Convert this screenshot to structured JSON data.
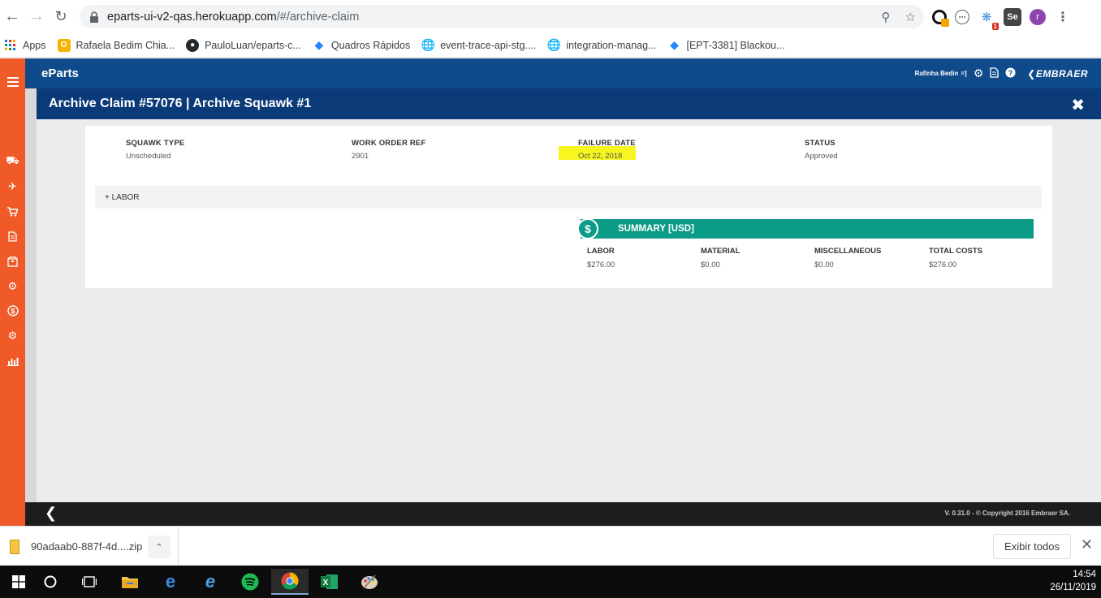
{
  "browser": {
    "url_host": "eparts-ui-v2-qas.herokuapp.com",
    "url_path": "/#/archive-claim",
    "bookmarks": [
      {
        "label": "Apps",
        "icon": "apps-grid-icon"
      },
      {
        "label": "Rafaela Bedim Chia...",
        "icon": "bookmark-o-icon"
      },
      {
        "label": "PauloLuan/eparts-c...",
        "icon": "github-icon"
      },
      {
        "label": "Quadros Rápidos",
        "icon": "jira-diamond-icon"
      },
      {
        "label": "event-trace-api-stg....",
        "icon": "globe-icon"
      },
      {
        "label": "integration-manag...",
        "icon": "globe-icon"
      },
      {
        "label": "[EPT-3381] Blackou...",
        "icon": "jira-diamond-icon"
      }
    ],
    "extensions": [
      {
        "label": "",
        "badge": "",
        "icon": "extension-ring-icon"
      },
      {
        "label": "",
        "badge": "",
        "icon": "extension-circle-icon"
      },
      {
        "label": "",
        "badge": "1",
        "icon": "extension-translate-icon"
      },
      {
        "label": "Se",
        "badge": "",
        "icon": "extension-selenium-icon"
      },
      {
        "label": "r",
        "badge": "",
        "icon": "profile-avatar-icon"
      }
    ]
  },
  "app": {
    "brand": "eParts",
    "user": "Rafinha Bedin",
    "user_suffix": "=]",
    "company": "EMBRAER",
    "modal_title": "Archive Claim #57076 | Archive Squawk #1",
    "close_glyph": "✖",
    "fields": [
      {
        "label": "SQUAWK TYPE",
        "value": "Unscheduled"
      },
      {
        "label": "WORK ORDER REF",
        "value": "2901"
      },
      {
        "label": "FAILURE DATE",
        "value": "Oct 22, 2018"
      },
      {
        "label": "STATUS",
        "value": "Approved"
      }
    ],
    "labor_toggle": "+ LABOR",
    "summary": {
      "title": "SUMMARY [USD]",
      "icon_glyph": "$",
      "columns": [
        {
          "label": "LABOR",
          "value": "$276.00"
        },
        {
          "label": "MATERIAL",
          "value": "$0.00"
        },
        {
          "label": "MISCELLANEOUS",
          "value": "$0.00"
        },
        {
          "label": "TOTAL COSTS",
          "value": "$276.00"
        }
      ]
    },
    "footer_copyright": "V. 0.31.0 - © Copyright 2016 Embraer SA.",
    "rail_icons": [
      "menu-icon",
      "truck-icon",
      "plane-icon",
      "cart-icon",
      "document-icon",
      "package-icon",
      "gear-icon",
      "dollar-circle-icon",
      "gears-icon",
      "bar-chart-icon"
    ]
  },
  "download": {
    "filename": "90adaab0-887f-4d....zip",
    "show_all": "Exibir todos"
  },
  "taskbar": {
    "time": "14:54",
    "date": "26/11/2019"
  },
  "colors": {
    "rail": "#f05a28",
    "topbar": "#0f4a8a",
    "modal_header": "#0b3a78",
    "summary": "#0b9b86",
    "highlight": "#f7f520"
  }
}
